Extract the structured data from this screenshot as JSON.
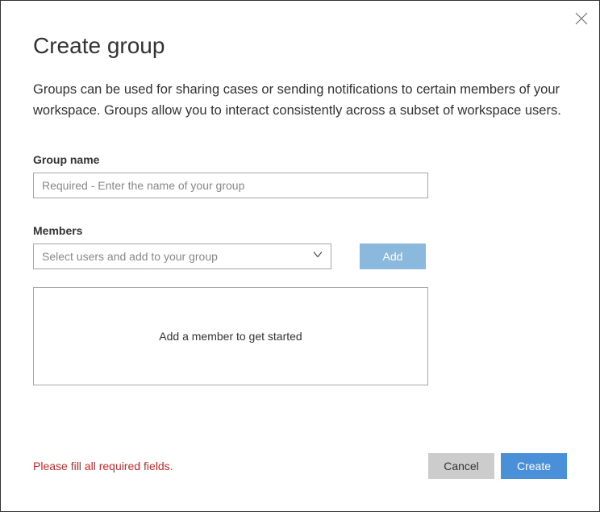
{
  "dialog": {
    "title": "Create group",
    "description": "Groups can be used for sharing cases or sending notifications to certain members of your workspace. Groups allow you to interact consistently across a subset of workspace users."
  },
  "group_name": {
    "label": "Group name",
    "placeholder": "Required - Enter the name of your group",
    "value": ""
  },
  "members": {
    "label": "Members",
    "select_placeholder": "Select users and add to your group",
    "add_button": "Add",
    "empty_message": "Add a member to get started"
  },
  "footer": {
    "error": "Please fill all required fields.",
    "cancel": "Cancel",
    "create": "Create"
  }
}
